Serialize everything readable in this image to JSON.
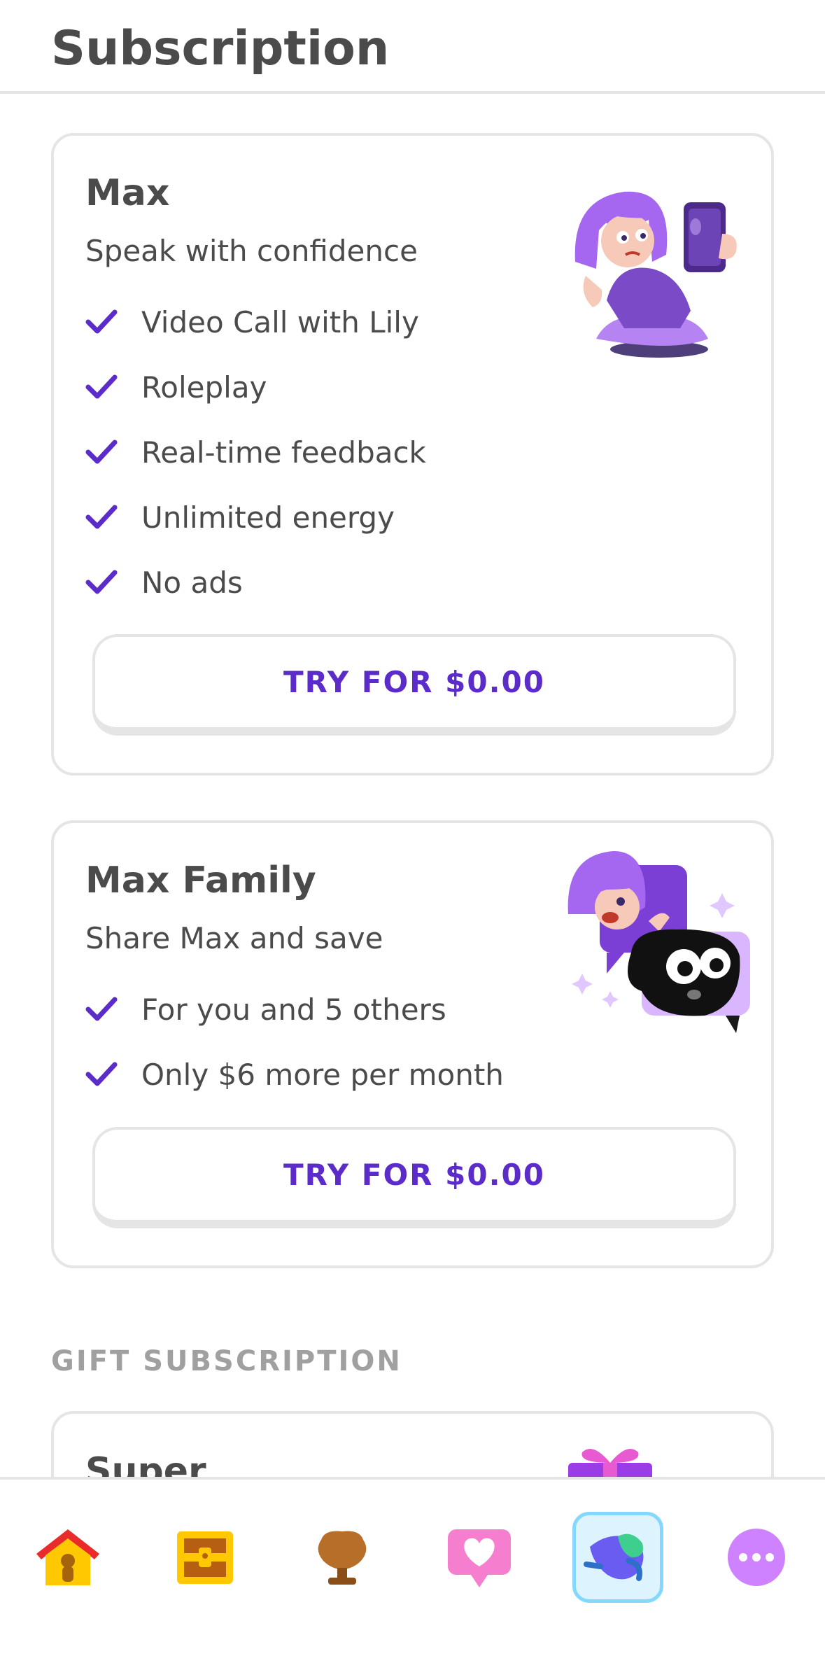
{
  "header": {
    "title": "Subscription"
  },
  "plans": [
    {
      "name": "Max",
      "tagline": "Speak with confidence",
      "features": [
        "Video Call with Lily",
        "Roleplay",
        "Real-time feedback",
        "Unlimited energy",
        "No ads"
      ],
      "cta": "TRY FOR $0.00"
    },
    {
      "name": "Max Family",
      "tagline": "Share Max and save",
      "features": [
        "For you and 5 others",
        "Only $6 more per month"
      ],
      "cta": "TRY FOR $0.00"
    }
  ],
  "gift": {
    "section_label": "GIFT SUBSCRIPTION",
    "title": "Super"
  },
  "nav": [
    {
      "icon": "home-icon",
      "active": false
    },
    {
      "icon": "treasure-chest-icon",
      "active": false
    },
    {
      "icon": "trophy-icon",
      "active": false
    },
    {
      "icon": "heart-bubble-icon",
      "active": false
    },
    {
      "icon": "max-bird-icon",
      "active": true
    },
    {
      "icon": "more-icon",
      "active": false
    }
  ],
  "colors": {
    "accent": "#5b2cc9",
    "border": "#e5e5e5",
    "text": "#4b4b4b",
    "muted": "#a0a0a0",
    "active_nav_bg": "#ddf4ff",
    "active_nav_border": "#84d8ff"
  }
}
